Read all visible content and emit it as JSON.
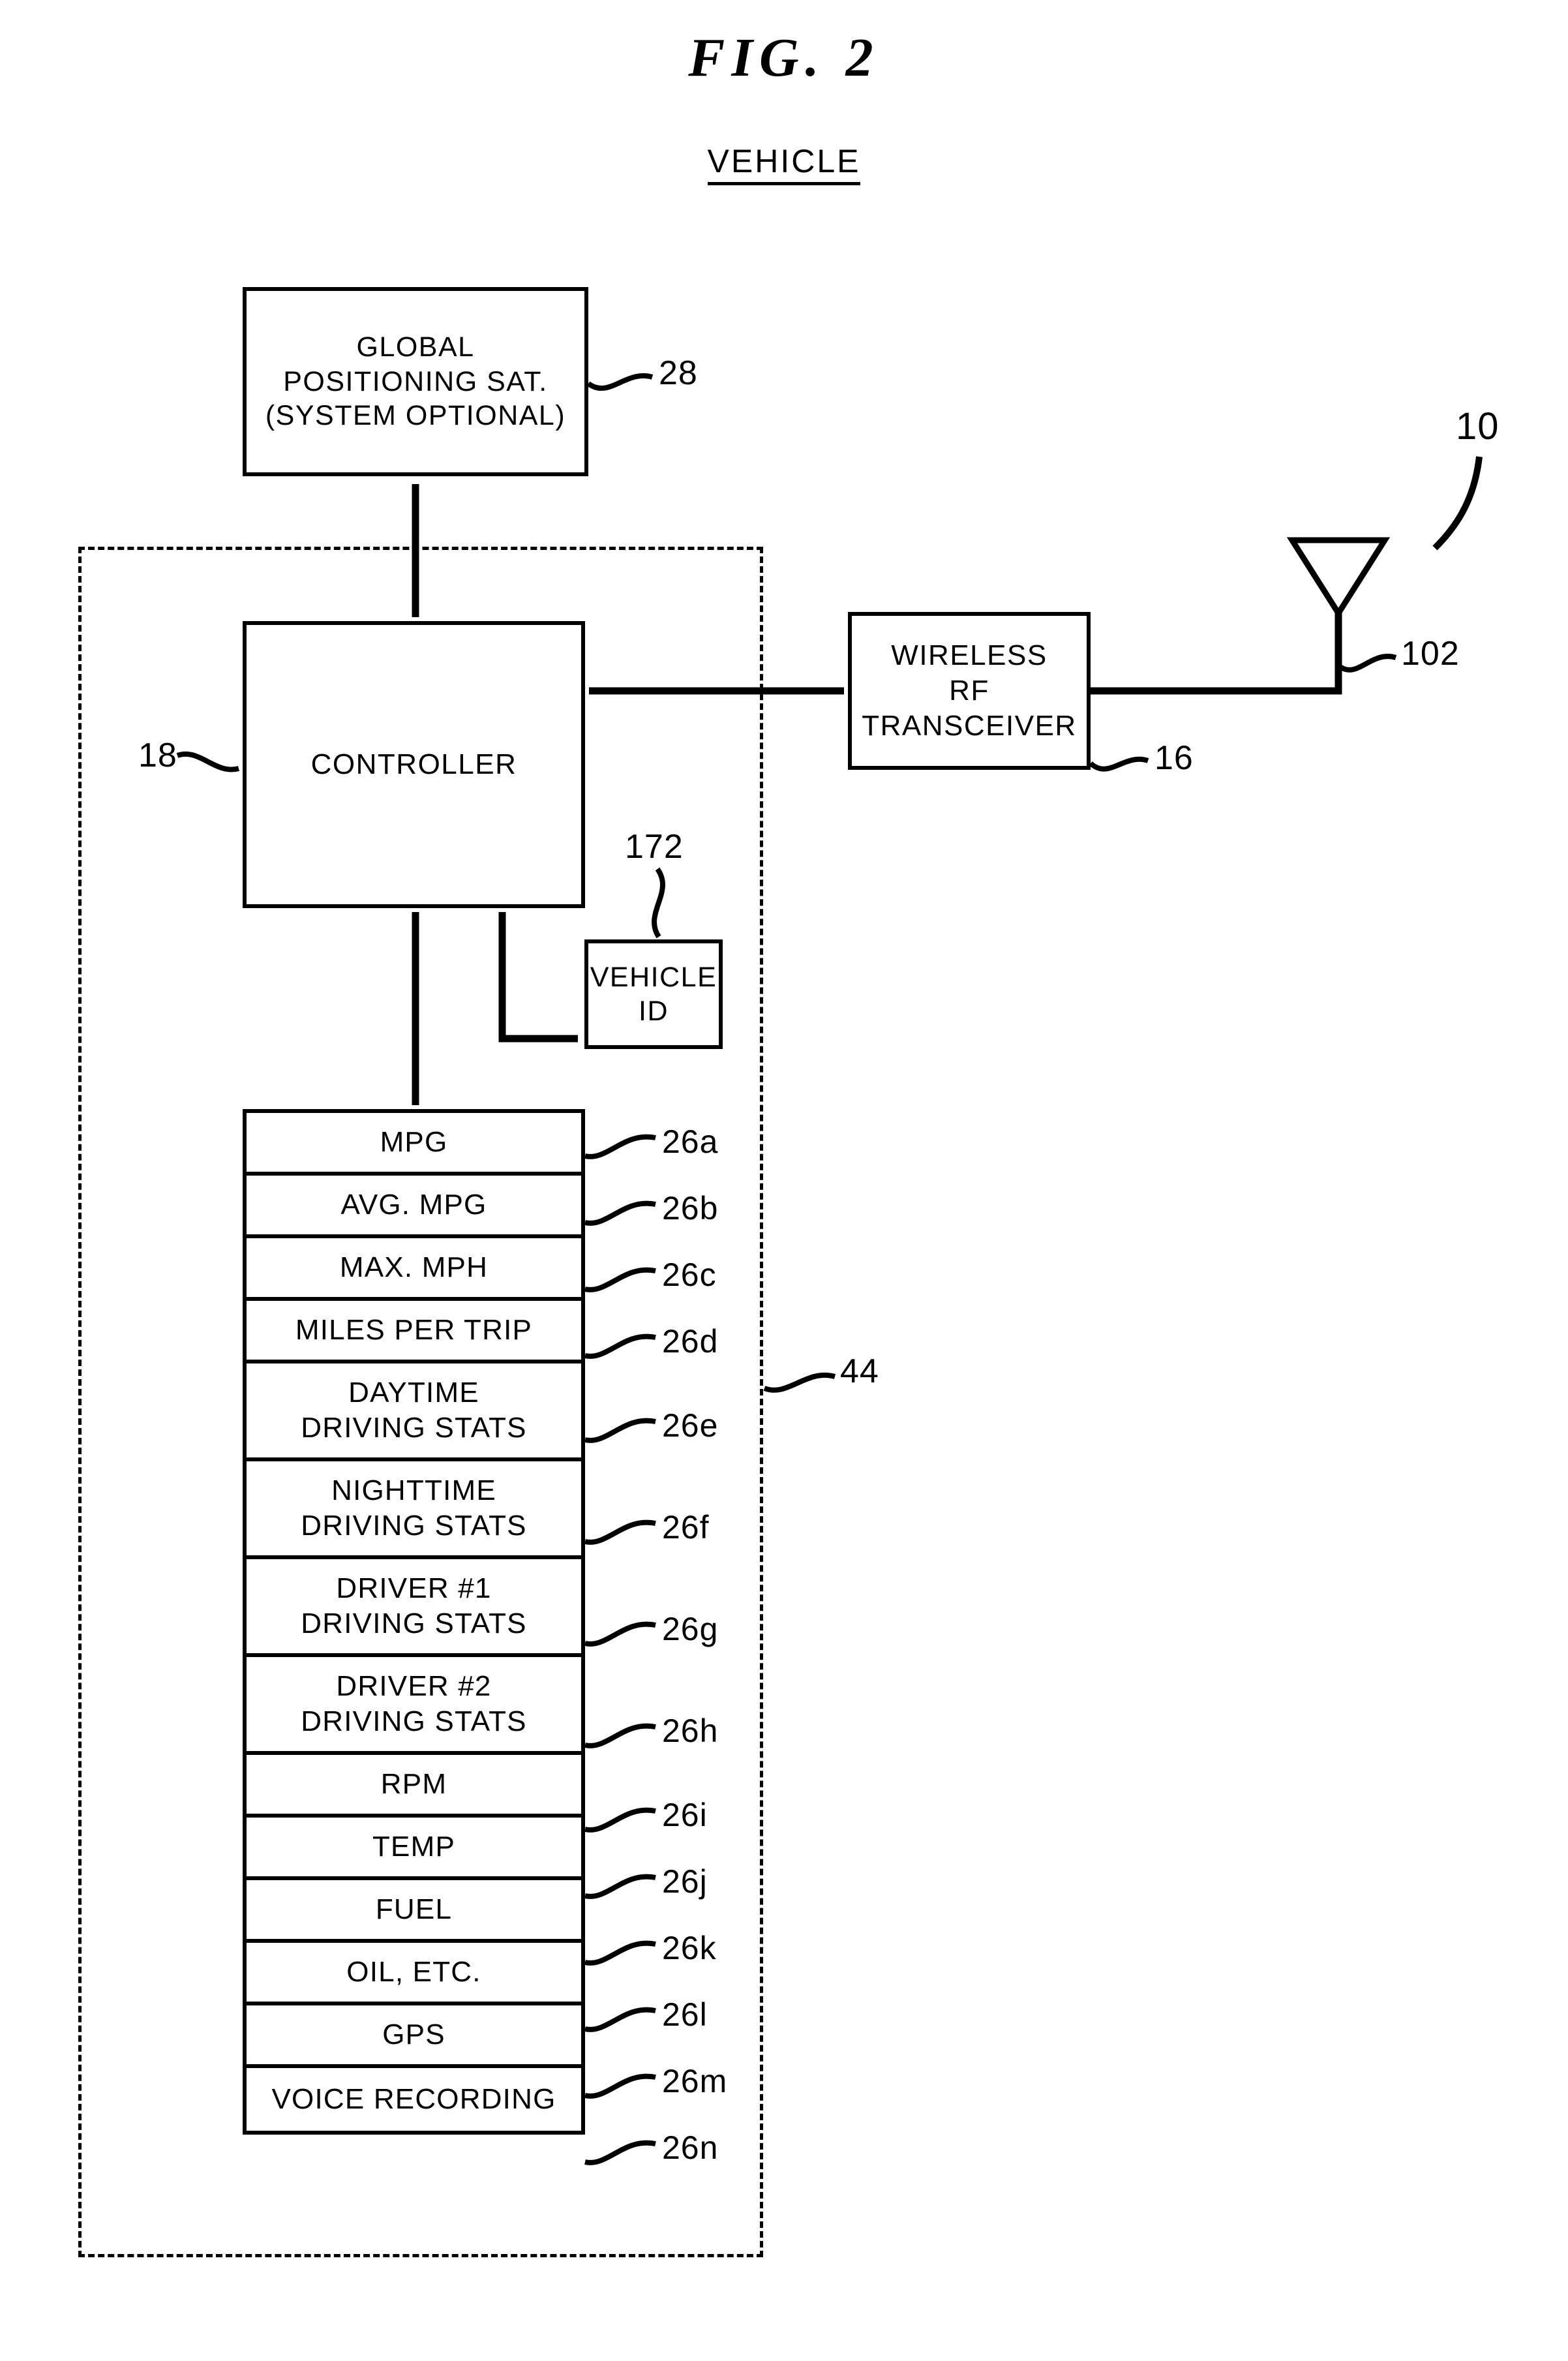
{
  "figure": {
    "title": "FIG. 2",
    "subtitle": "VEHICLE",
    "system_ref": "10",
    "boundary_ref": "44"
  },
  "blocks": {
    "gps": {
      "line1": "GLOBAL",
      "line2": "POSITIONING SAT.",
      "line3": "(SYSTEM OPTIONAL)",
      "ref": "28"
    },
    "controller": {
      "label": "CONTROLLER",
      "ref": "18"
    },
    "transceiver": {
      "line1": "WIRELESS",
      "line2": "RF",
      "line3": "TRANSCEIVER",
      "ref": "16"
    },
    "antenna": {
      "ref": "102"
    },
    "vehicle_id": {
      "line1": "VEHICLE",
      "line2": "ID",
      "ref": "172"
    }
  },
  "sensor_stack": {
    "ref": "44",
    "rows": [
      {
        "line1": "MPG",
        "line2": "",
        "ref": "26a",
        "tall": false
      },
      {
        "line1": "AVG. MPG",
        "line2": "",
        "ref": "26b",
        "tall": false
      },
      {
        "line1": "MAX. MPH",
        "line2": "",
        "ref": "26c",
        "tall": false
      },
      {
        "line1": "MILES PER TRIP",
        "line2": "",
        "ref": "26d",
        "tall": false
      },
      {
        "line1": "DAYTIME",
        "line2": "DRIVING  STATS",
        "ref": "26e",
        "tall": true
      },
      {
        "line1": "NIGHTTIME",
        "line2": "DRIVING  STATS",
        "ref": "26f",
        "tall": true
      },
      {
        "line1": "DRIVER  #1",
        "line2": "DRIVING  STATS",
        "ref": "26g",
        "tall": true
      },
      {
        "line1": "DRIVER  #2",
        "line2": "DRIVING  STATS",
        "ref": "26h",
        "tall": true
      },
      {
        "line1": "RPM",
        "line2": "",
        "ref": "26i",
        "tall": false
      },
      {
        "line1": "TEMP",
        "line2": "",
        "ref": "26j",
        "tall": false
      },
      {
        "line1": "FUEL",
        "line2": "",
        "ref": "26k",
        "tall": false
      },
      {
        "line1": "OIL, ETC.",
        "line2": "",
        "ref": "26l",
        "tall": false
      },
      {
        "line1": "GPS",
        "line2": "",
        "ref": "26m",
        "tall": false
      },
      {
        "line1": "VOICE RECORDING",
        "line2": "",
        "ref": "26n",
        "tall": false
      }
    ]
  },
  "colors": {
    "ink": "#000000",
    "paper": "#ffffff"
  }
}
